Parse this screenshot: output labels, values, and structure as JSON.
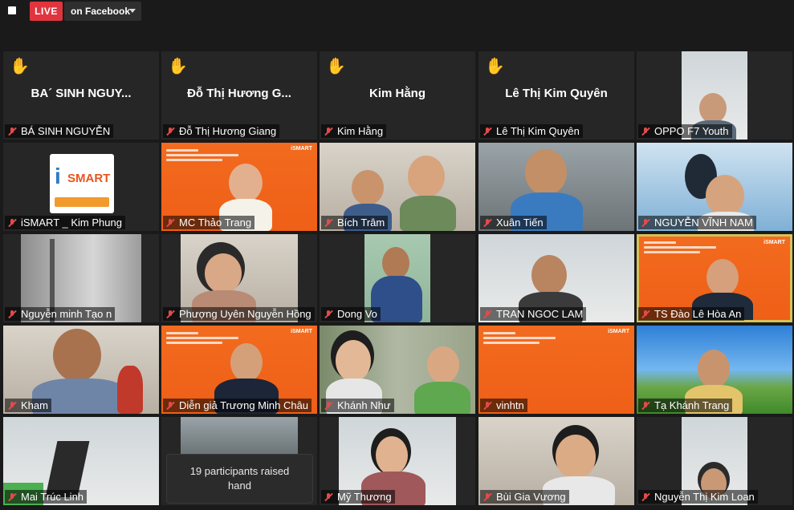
{
  "topbar": {
    "live_label": "LIVE",
    "destination": "on Facebook"
  },
  "tiles": [
    {
      "name": "BÁ SINH NGUYỄN",
      "center_name": "BA´ SINH NGUY...",
      "hand_raised": true,
      "muted": true
    },
    {
      "name": "Đỗ Thị Hương Giang",
      "center_name": "Đỗ Thị Hương G...",
      "hand_raised": true,
      "muted": true
    },
    {
      "name": "Kim Hằng",
      "center_name": "Kim Hằng",
      "hand_raised": true,
      "muted": true
    },
    {
      "name": "Lê Thị Kim Quyên",
      "center_name": "Lê Thị Kim Quyên",
      "hand_raised": true,
      "muted": true
    },
    {
      "name": "OPPO F7 Youth",
      "muted": true
    },
    {
      "name": "iSMART _ Kim Phung",
      "muted": true
    },
    {
      "name": "MC Thảo Trang",
      "muted": true
    },
    {
      "name": "Bích Trâm",
      "muted": true
    },
    {
      "name": "Xuân Tiến",
      "muted": true
    },
    {
      "name": "NGUYỄN VĨNH NAM",
      "muted": true
    },
    {
      "name": "Nguyễn minh Tạo n",
      "muted": true
    },
    {
      "name": "Phượng Uyên Nguyễn Hồng",
      "muted": true
    },
    {
      "name": "Dong Vo",
      "muted": true
    },
    {
      "name": "TRAN NGOC LAM",
      "muted": true
    },
    {
      "name": "TS Đào Lê Hòa An",
      "muted": true,
      "active_speaker": true
    },
    {
      "name": "Kham",
      "muted": true
    },
    {
      "name": "Diễn giả Trương Minh Châu",
      "muted": true
    },
    {
      "name": "Khánh Như",
      "muted": true
    },
    {
      "name": "vinhtn",
      "muted": true
    },
    {
      "name": "Tạ Khánh Trang",
      "muted": true
    },
    {
      "name": "Mai Trúc Linh",
      "muted": true
    },
    {
      "name": "",
      "muted": false
    },
    {
      "name": "Mỹ Thương",
      "muted": true
    },
    {
      "name": "Bùi Gia Vương",
      "muted": true
    },
    {
      "name": "Nguyễn Thị Kim Loan",
      "muted": true
    }
  ],
  "toast": {
    "line1": "19 participants raised",
    "line2": "hand"
  },
  "colors": {
    "live_red": "#e0353e",
    "slide_orange": "#f26b1f",
    "active_border": "#d6c25b",
    "muted_red": "#e14b4b"
  }
}
